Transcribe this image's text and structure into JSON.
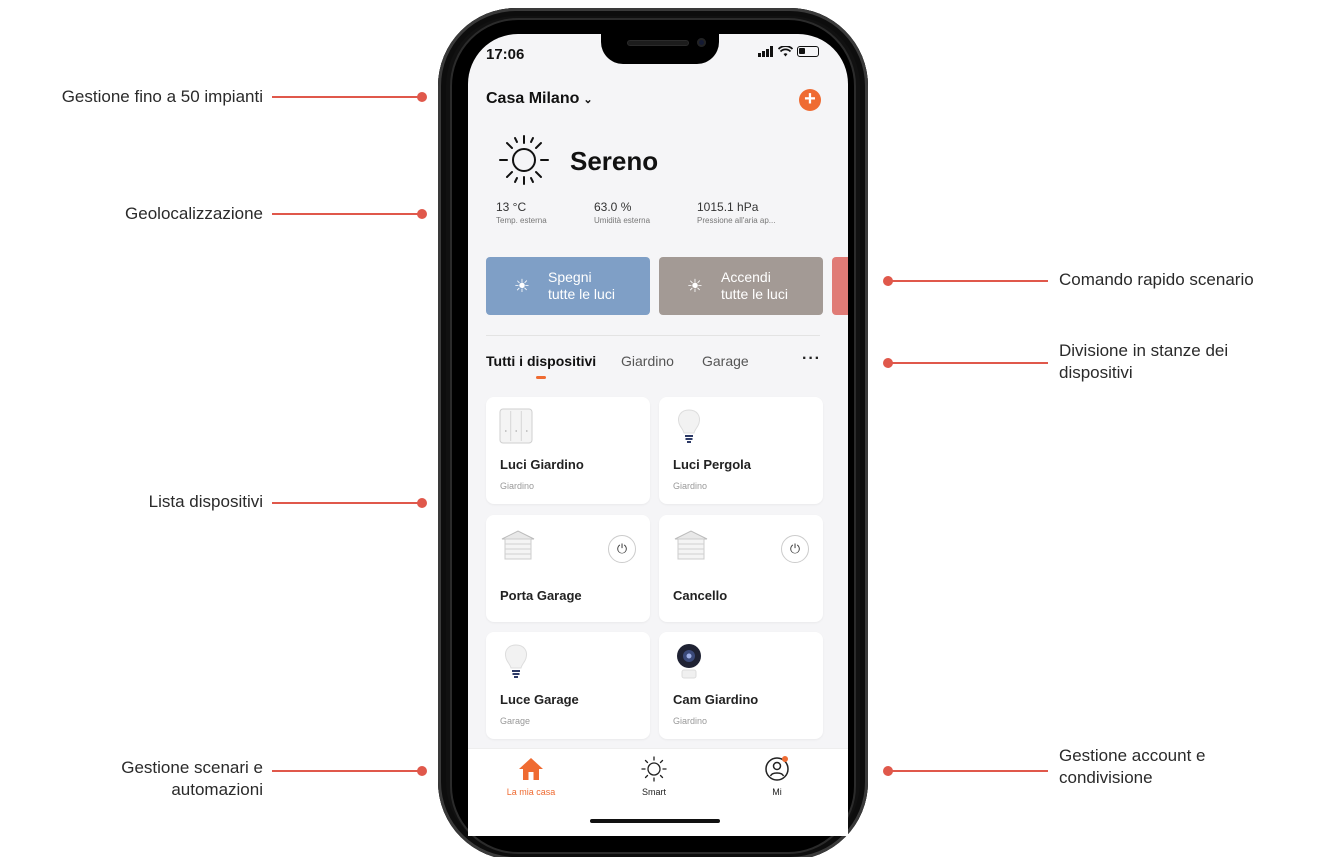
{
  "callouts": {
    "left": [
      {
        "text": "Gestione fino a 50 impianti"
      },
      {
        "text": "Geolocalizzazione"
      },
      {
        "text": "Lista dispositivi"
      },
      {
        "text": "Gestione scenari e\nautomazioni"
      }
    ],
    "right": [
      {
        "text": "Comando rapido scenario"
      },
      {
        "text": "Divisione in stanze dei\ndispositivi"
      },
      {
        "text": "Gestione account e\ncondivisione"
      }
    ]
  },
  "status_bar": {
    "time": "17:06"
  },
  "header": {
    "home_name": "Casa Milano"
  },
  "weather": {
    "condition": "Sereno",
    "stats": [
      {
        "value": "13 °C",
        "label": "Temp. esterna"
      },
      {
        "value": "63.0 %",
        "label": "Umidità esterna"
      },
      {
        "value": "1015.1 hPa",
        "label": "Pressione all'aria ap..."
      }
    ]
  },
  "scenes": [
    {
      "label_line1": "Spegni",
      "label_line2": "tutte le luci",
      "color": "#7f9fc6"
    },
    {
      "label_line1": "Accendi",
      "label_line2": "tutte le luci",
      "color": "#a39a95"
    }
  ],
  "scene_peek_color": "#e07b76",
  "rooms": {
    "tabs": [
      "Tutti i dispositivi",
      "Giardino",
      "Garage"
    ],
    "active": 0
  },
  "devices": [
    {
      "name": "Luci Giardino",
      "room": "Giardino",
      "icon": "switch-icon"
    },
    {
      "name": "Luci Pergola",
      "room": "Giardino",
      "icon": "bulb-icon"
    },
    {
      "name": "Porta Garage",
      "room": "",
      "icon": "garage-door-icon",
      "power": true
    },
    {
      "name": "Cancello",
      "room": "",
      "icon": "garage-door-icon",
      "power": true
    },
    {
      "name": "Luce Garage",
      "room": "Garage",
      "icon": "bulb-icon"
    },
    {
      "name": "Cam Giardino",
      "room": "Giardino",
      "icon": "camera-icon"
    }
  ],
  "nav": [
    {
      "label": "La mia casa",
      "icon": "home-icon",
      "active": true
    },
    {
      "label": "Smart",
      "icon": "sun-icon",
      "active": false
    },
    {
      "label": "Mi",
      "icon": "profile-icon",
      "active": false
    }
  ],
  "accent_color": "#ef6b32",
  "callout_color": "#e0584b"
}
